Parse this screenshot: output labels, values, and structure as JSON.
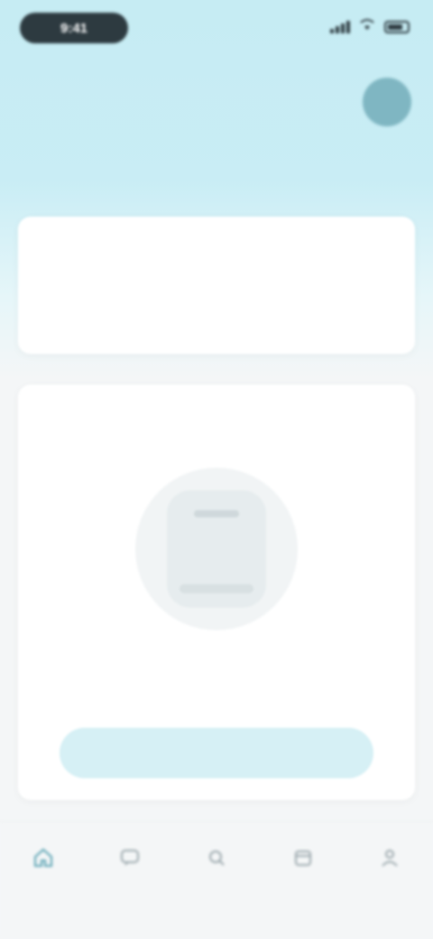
{
  "status_bar": {
    "time": "9:41"
  },
  "header": {
    "title": "",
    "subtitle": "",
    "meta": "",
    "avatar_initials": ""
  },
  "top_card": {
    "title": ""
  },
  "main_card": {
    "title": "",
    "empty_text": "",
    "cta_label": ""
  },
  "bottom_nav": {
    "items": [
      {
        "label": "",
        "icon": "home-icon"
      },
      {
        "label": "",
        "icon": "chat-icon"
      },
      {
        "label": "",
        "icon": "search-icon"
      },
      {
        "label": "",
        "icon": "calendar-icon"
      },
      {
        "label": "",
        "icon": "profile-icon"
      }
    ]
  },
  "colors": {
    "accent": "#5aa3b3",
    "header_bg": "#c6ecf3",
    "text_dark": "#2d3a40"
  }
}
